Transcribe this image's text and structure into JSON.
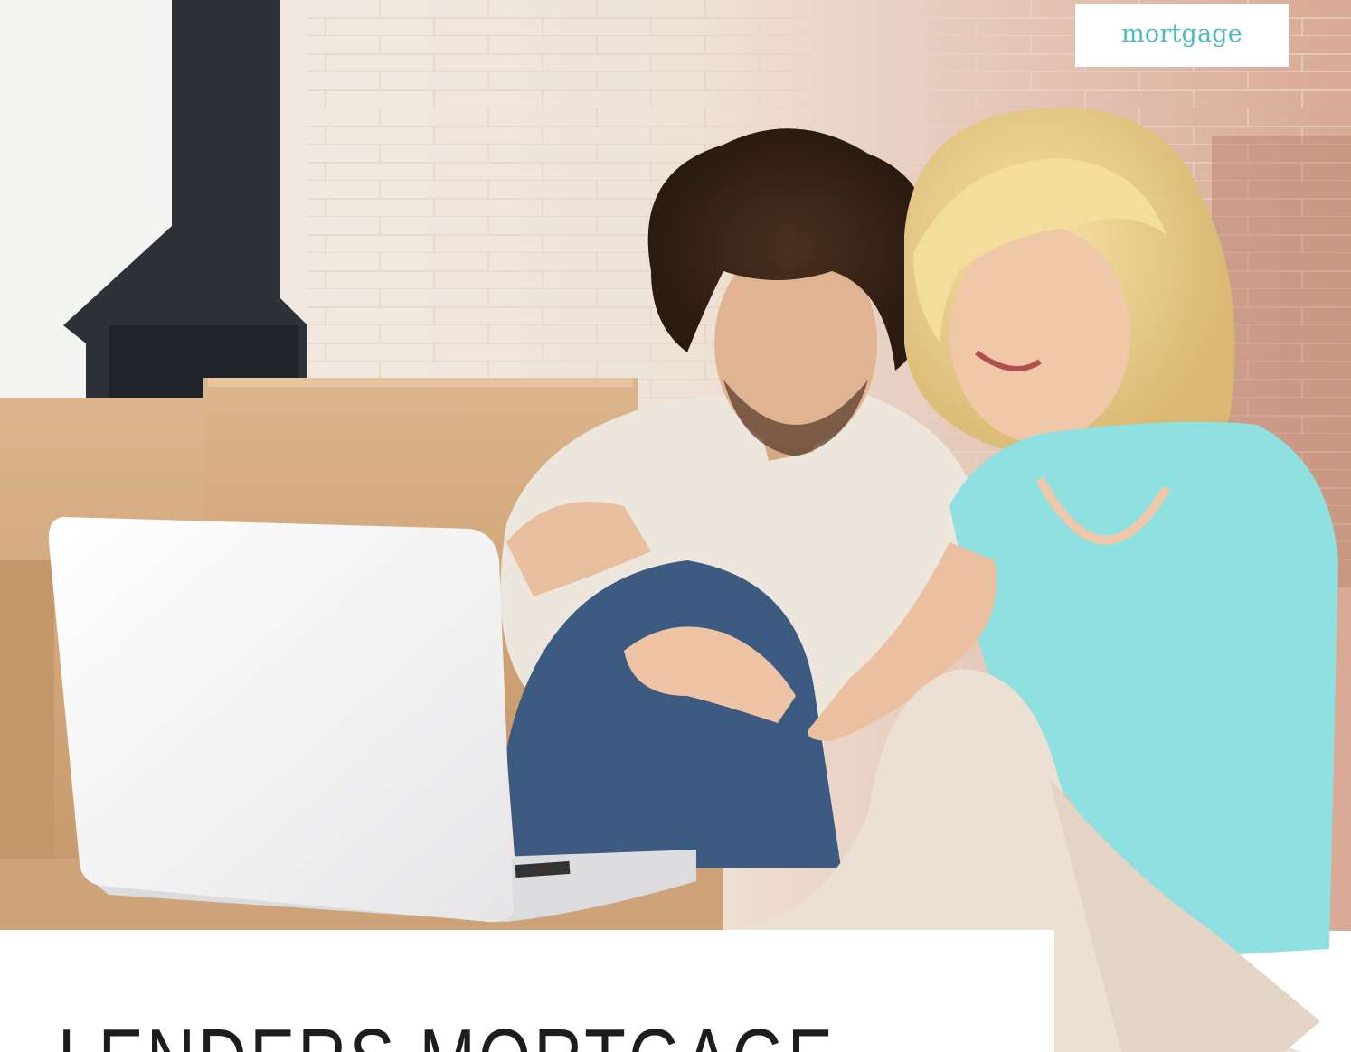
{
  "section_label": "mortgage",
  "headline": "LENDERS MORTGAGE",
  "photo": {
    "subject": "couple-using-laptop-illustration"
  },
  "colors": {
    "accent": "#4fb9c0",
    "headline": "#1d1d1b",
    "shirt": "#8fe0e0",
    "boxes": "#d4a87a"
  }
}
